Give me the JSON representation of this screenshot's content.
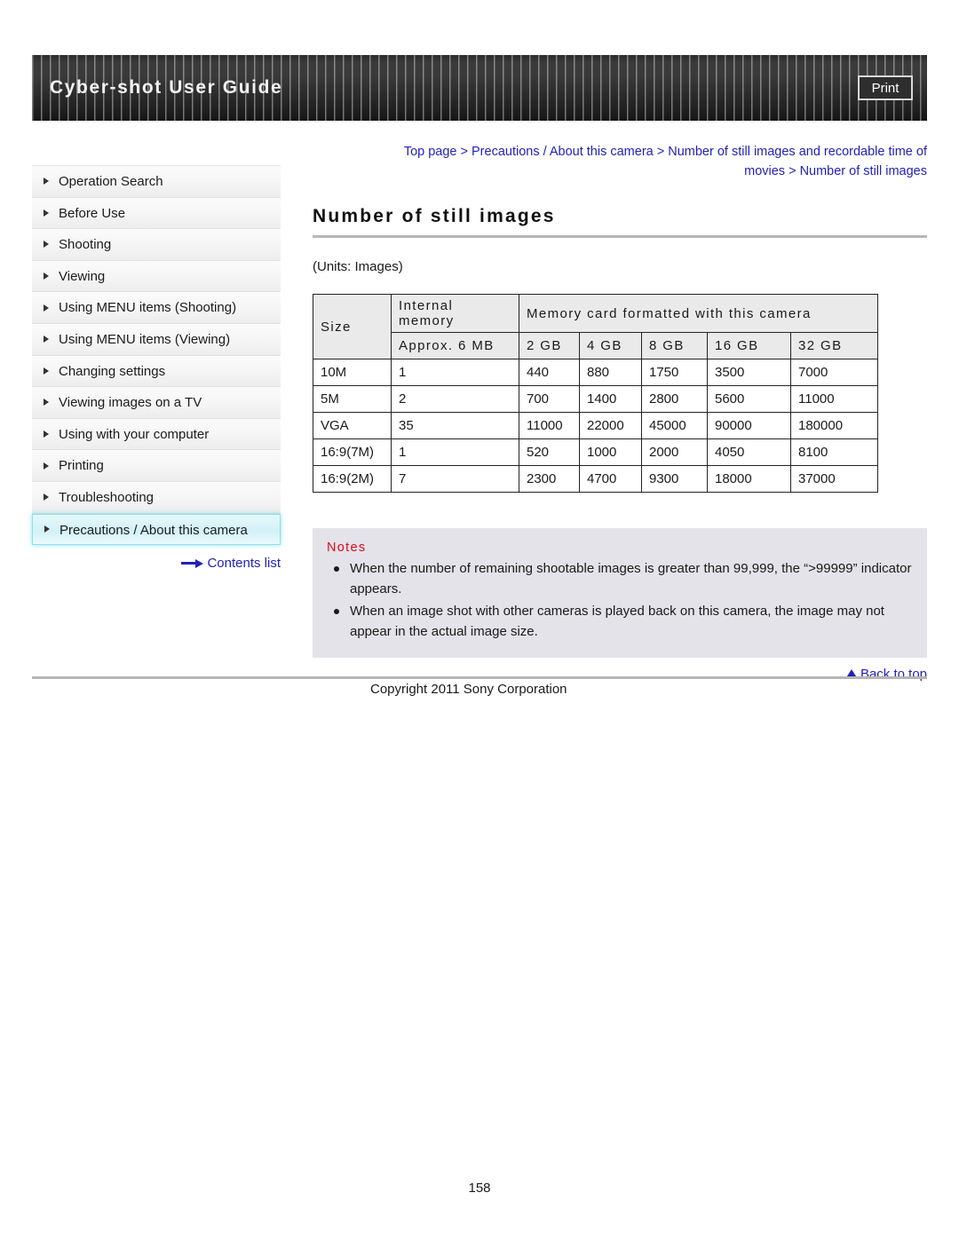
{
  "header": {
    "title": "Cyber-shot User Guide",
    "print_label": "Print"
  },
  "sidebar": {
    "items": [
      {
        "label": "Operation Search"
      },
      {
        "label": "Before Use"
      },
      {
        "label": "Shooting"
      },
      {
        "label": "Viewing"
      },
      {
        "label": "Using MENU items (Shooting)"
      },
      {
        "label": "Using MENU items (Viewing)"
      },
      {
        "label": "Changing settings"
      },
      {
        "label": "Viewing images on a TV"
      },
      {
        "label": "Using with your computer"
      },
      {
        "label": "Printing"
      },
      {
        "label": "Troubleshooting"
      },
      {
        "label": "Precautions / About this camera"
      }
    ],
    "selected_index": 11,
    "contents_link": "Contents list"
  },
  "main": {
    "breadcrumb_line1": "Top page > Precautions / About this camera > Number of still images and recordable time of",
    "breadcrumb_line2": "movies > Number of still images",
    "title": "Number of still images",
    "units": "(Units: Images)"
  },
  "table": {
    "header_row1": {
      "size": "Size",
      "internal_memory": "Internal memory",
      "memory_card": "Memory card formatted with this camera"
    },
    "header_row2": {
      "internal_capacity": "Approx. 6 MB",
      "capacities": [
        "2 GB",
        "4 GB",
        "8 GB",
        "16 GB",
        "32 GB"
      ]
    },
    "rows": [
      {
        "size": "10M",
        "internal": "1",
        "values": [
          "440",
          "880",
          "1750",
          "3500",
          "7000"
        ]
      },
      {
        "size": "5M",
        "internal": "2",
        "values": [
          "700",
          "1400",
          "2800",
          "5600",
          "11000"
        ]
      },
      {
        "size": "VGA",
        "internal": "35",
        "values": [
          "11000",
          "22000",
          "45000",
          "90000",
          "180000"
        ]
      },
      {
        "size": "16:9(7M)",
        "internal": "1",
        "values": [
          "520",
          "1000",
          "2000",
          "4050",
          "8100"
        ]
      },
      {
        "size": "16:9(2M)",
        "internal": "7",
        "values": [
          "2300",
          "4700",
          "9300",
          "18000",
          "37000"
        ]
      }
    ]
  },
  "notes": {
    "title": "Notes",
    "items": [
      "When the number of remaining shootable images is greater than 99,999, the “>99999” indicator appears.",
      "When an image shot with other cameras is played back on this camera, the image may not appear in the actual image size."
    ]
  },
  "footer": {
    "back_to_top": "Back to top",
    "copyright": "Copyright 2011 Sony Corporation",
    "page_number": "158"
  },
  "colors": {
    "link": "#2222bb",
    "notes_title": "#e2081a",
    "selected_nav": "#d3f1f7",
    "banner_dark": "#2b2b2b"
  }
}
